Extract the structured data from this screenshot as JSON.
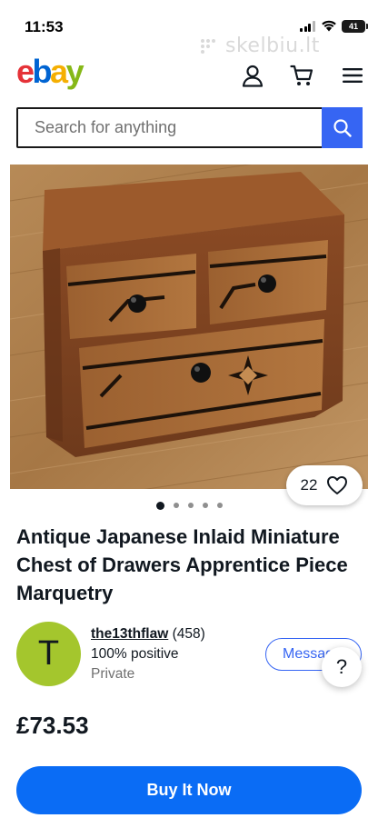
{
  "status_bar": {
    "time": "11:53",
    "battery": "41",
    "watermark": "skelbiu.lt"
  },
  "header": {
    "logo_letters": [
      "e",
      "b",
      "a",
      "y"
    ],
    "logo_colors": [
      "#e53238",
      "#0064d2",
      "#f5af02",
      "#86b817"
    ],
    "icons": [
      "user-icon",
      "cart-icon",
      "menu-icon"
    ]
  },
  "search": {
    "placeholder": "Search for anything",
    "value": "",
    "button_icon": "search-icon",
    "button_color": "#3665f3"
  },
  "gallery": {
    "watch_count": "22",
    "watch_icon": "heart-icon",
    "image_count": 5,
    "active_index": 0
  },
  "item": {
    "title": "Antique Japanese Inlaid Miniature Chest of Drawers Apprentice Piece Marquetry",
    "price": "£73.53"
  },
  "seller": {
    "avatar_letter": "T",
    "avatar_color": "#a4c62d",
    "name": "the13thflaw",
    "feedback_count": "(458)",
    "positive": "100% positive",
    "status": "Private",
    "message_label": "Message"
  },
  "help": {
    "label": "?"
  },
  "actions": {
    "buy_label": "Buy It Now",
    "buy_color": "#0a6cf5"
  }
}
